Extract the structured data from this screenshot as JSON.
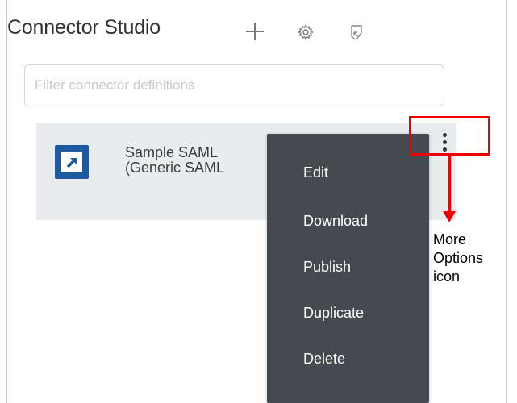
{
  "header": {
    "title": "Connector Studio",
    "icons": [
      "plus-icon",
      "gear-icon",
      "import-icon"
    ]
  },
  "filter": {
    "placeholder": "Filter connector definitions",
    "value": ""
  },
  "connector": {
    "name_line1": "Sample SAML",
    "name_line2": "(Generic SAML",
    "icon": "connector-app-icon",
    "icon_color": "#1e5aa0"
  },
  "menu": {
    "items": [
      "Edit",
      "Download",
      "Publish",
      "Duplicate",
      "Delete"
    ],
    "background": "#444a4f"
  },
  "annotation": {
    "line1": "More",
    "line2": "Options",
    "line3": "icon",
    "color": "#ee0000"
  }
}
